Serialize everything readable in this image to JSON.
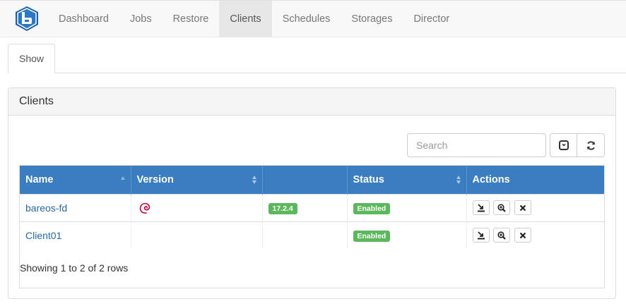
{
  "navbar": {
    "items": [
      {
        "label": "Dashboard",
        "active": false
      },
      {
        "label": "Jobs",
        "active": false
      },
      {
        "label": "Restore",
        "active": false
      },
      {
        "label": "Clients",
        "active": true
      },
      {
        "label": "Schedules",
        "active": false
      },
      {
        "label": "Storages",
        "active": false
      },
      {
        "label": "Director",
        "active": false
      }
    ]
  },
  "tabs": [
    {
      "label": "Show"
    }
  ],
  "panel": {
    "title": "Clients",
    "search_placeholder": "Search",
    "toolbar_icons": [
      "columns-toggle-icon",
      "refresh-icon"
    ]
  },
  "table": {
    "columns": [
      "Name",
      "Version",
      "",
      "Status",
      "Actions"
    ],
    "rows": [
      {
        "name": "bareos-fd",
        "os_icon": "debian-icon",
        "version": "17.2.4",
        "status": "Enabled"
      },
      {
        "name": "Client01",
        "os_icon": "",
        "version": "",
        "status": "Enabled"
      }
    ],
    "footer": "Showing 1 to 2 of 2 rows"
  },
  "colors": {
    "header_blue": "#3a7dc1",
    "status_green": "#5cb85c",
    "link": "#2a6aa6"
  }
}
